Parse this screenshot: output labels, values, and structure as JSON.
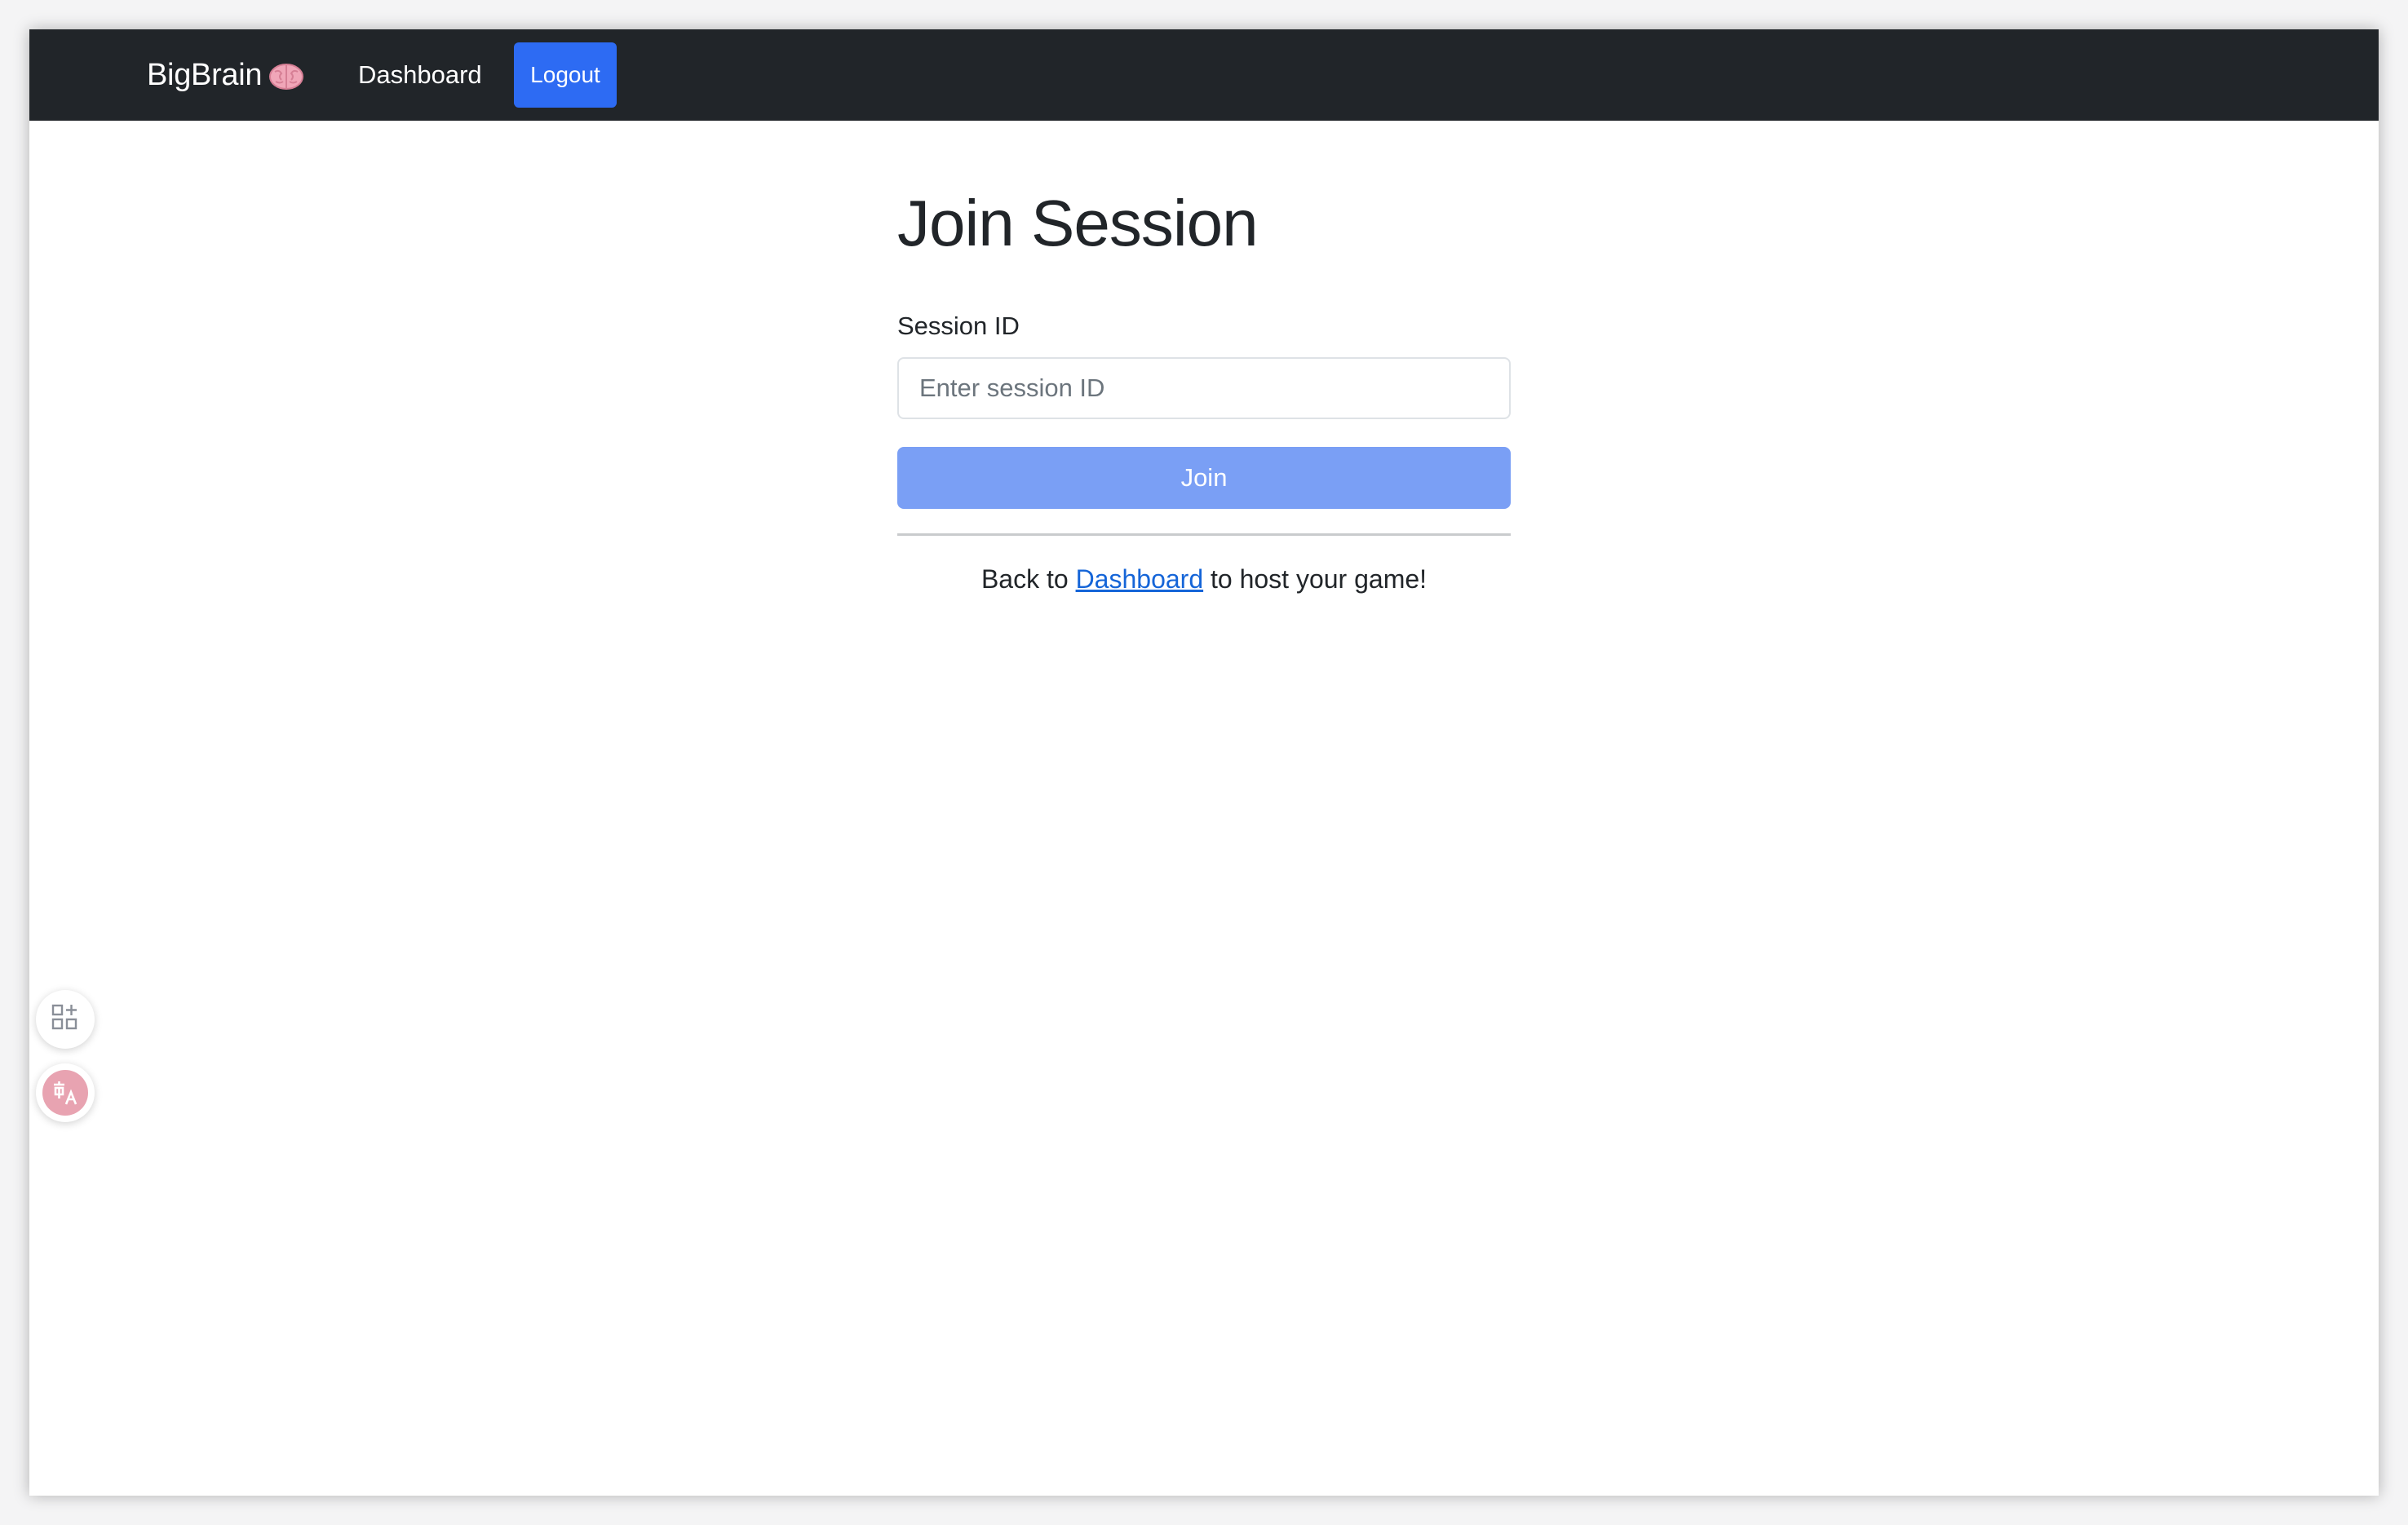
{
  "navbar": {
    "brand": "BigBrain",
    "brand_icon": "brain-icon",
    "dashboard_link": "Dashboard",
    "logout_label": "Logout"
  },
  "main": {
    "title": "Join Session",
    "session_label": "Session ID",
    "session_input": {
      "value": "",
      "placeholder": "Enter session ID"
    },
    "join_label": "Join",
    "back_prefix": "Back to",
    "back_link": "Dashboard",
    "back_suffix": "to host your game!"
  },
  "floating": {
    "apps_icon": "apps-add-icon",
    "translate_icon": "translate-icon"
  },
  "colors": {
    "navbar_bg": "#212529",
    "primary": "#2d6bf3",
    "join_disabled": "#7a9ff5",
    "link": "#1565d8",
    "translate_accent": "#e8a3b1"
  }
}
